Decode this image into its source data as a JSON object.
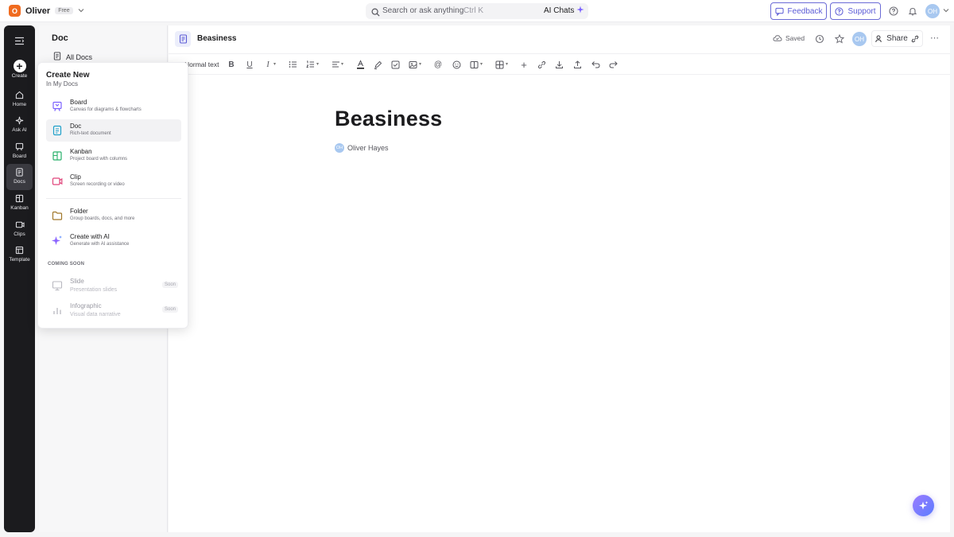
{
  "topbar": {
    "workspace_initial": "O",
    "workspace_name": "Oliver",
    "plan_badge": "Free",
    "search_placeholder": "Search or ask anything",
    "search_shortcut": "Ctrl K",
    "ai_chats_label": "AI Chats",
    "feedback_label": "Feedback",
    "support_label": "Support",
    "user_initials": "OH"
  },
  "rail": {
    "items": [
      {
        "label": "Create",
        "icon": "plus-icon"
      },
      {
        "label": "Home",
        "icon": "home-icon"
      },
      {
        "label": "Ask AI",
        "icon": "sparkle-icon"
      },
      {
        "label": "Board",
        "icon": "board-icon"
      },
      {
        "label": "Docs",
        "icon": "doc-icon",
        "active": true
      },
      {
        "label": "Kanban",
        "icon": "kanban-icon"
      },
      {
        "label": "Clips",
        "icon": "clip-icon"
      },
      {
        "label": "Template",
        "icon": "template-icon"
      }
    ]
  },
  "sidebar": {
    "title": "Doc",
    "all_docs_label": "All Docs"
  },
  "popup": {
    "title": "Create New",
    "subtitle": "In My Docs",
    "items": [
      {
        "label": "Board",
        "desc": "Canvas for diagrams & flowcharts",
        "icon": "board-icon"
      },
      {
        "label": "Doc",
        "desc": "Rich-text document",
        "icon": "doc-icon"
      },
      {
        "label": "Kanban",
        "desc": "Project board with columns",
        "icon": "kanban-icon"
      },
      {
        "label": "Clip",
        "desc": "Screen recording or video",
        "icon": "clip-icon"
      },
      {
        "label": "Folder",
        "desc": "Group boards, docs, and more",
        "icon": "folder-icon"
      },
      {
        "label": "Create with AI",
        "desc": "Generate with AI assistance",
        "icon": "sparkle-icon"
      }
    ],
    "coming_soon_heading": "COMING SOON",
    "coming_soon": [
      {
        "label": "Slide",
        "desc": "Presentation slides",
        "badge": "Soon",
        "icon": "slide-icon"
      },
      {
        "label": "Infographic",
        "desc": "Visual data narrative",
        "badge": "Soon",
        "icon": "chart-icon"
      }
    ]
  },
  "doc": {
    "header_title": "Beasiness",
    "saved_label": "Saved",
    "share_label": "Share",
    "user_initials": "OH",
    "toolbar_style": "Normal text",
    "title": "Beasiness",
    "author": "Oliver Hayes",
    "author_initials": "OH"
  },
  "colors": {
    "accent": "#5b5bd6",
    "rail_bg": "#1b1b1e",
    "workspace": "#f06b1f"
  }
}
